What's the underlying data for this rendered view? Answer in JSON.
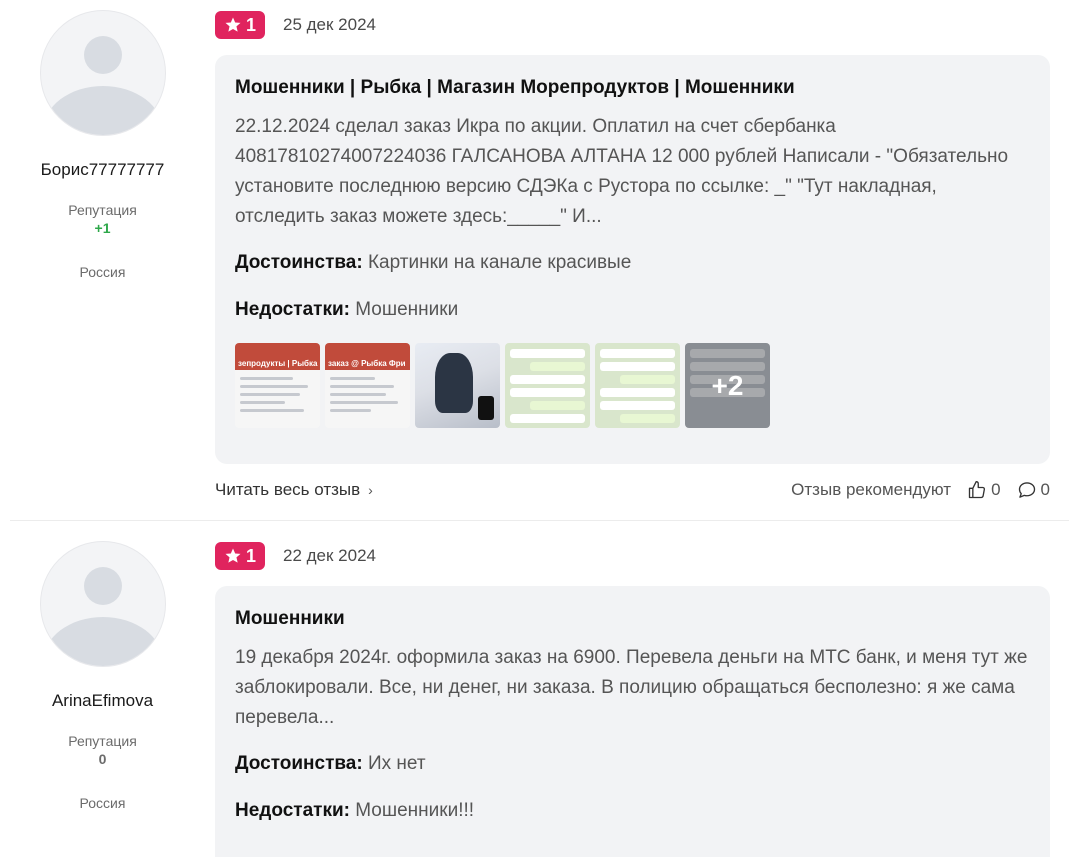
{
  "reviews": [
    {
      "author": {
        "name": "Борис77777777",
        "reputation_label": "Репутация",
        "reputation_value": "+1",
        "country": "Россия"
      },
      "rating": "1",
      "date": "25 дек 2024",
      "title": "Мошенники | Рыбка | Магазин Морепродуктов | Мошенники",
      "text": "22.12.2024 сделал заказ Икра по акции. Оплатил на счет сбербанка 40817810274007224036 ГАЛСАНОВА АЛТАНА 12 000 рублей Написали - \"Обязательно установите последнюю версию СДЭКа с Рустора по ссылке: _\" \"Тут накладная, отследить заказ можете здесь:_____\" И...",
      "pros_label": "Достоинства:",
      "pros": "Картинки на канале красивые",
      "cons_label": "Недостатки:",
      "cons": "Мошенники",
      "thumb_overlay_1": "зепродукты | Рыбка | М",
      "thumb_overlay_2": "заказ @ Рыбка Фри",
      "more_photos": "+2",
      "read_more": "Читать весь отзыв",
      "recommend_label": "Отзыв рекомендуют",
      "likes": "0",
      "comments": "0"
    },
    {
      "author": {
        "name": "ArinaEfimova",
        "reputation_label": "Репутация",
        "reputation_value": "0",
        "country": "Россия"
      },
      "rating": "1",
      "date": "22 дек 2024",
      "title": "Мошенники",
      "text": "19 декабря 2024г. оформила заказ на 6900. Перевела деньги на МТС банк, и меня тут же заблокировали. Все, ни денег, ни заказа. В полицию обращаться бесполезно: я же сама перевела...",
      "pros_label": "Достоинства:",
      "pros": "Их нет",
      "cons_label": "Недостатки:",
      "cons": "Мошенники!!!"
    }
  ],
  "colors": {
    "badge": "#e0245e",
    "reputation_positive": "#2ea84a",
    "card_bg": "#f2f3f5"
  },
  "icons": [
    "star-icon",
    "chevron-right-icon",
    "thumbs-up-icon",
    "comment-icon",
    "avatar-placeholder-icon"
  ]
}
